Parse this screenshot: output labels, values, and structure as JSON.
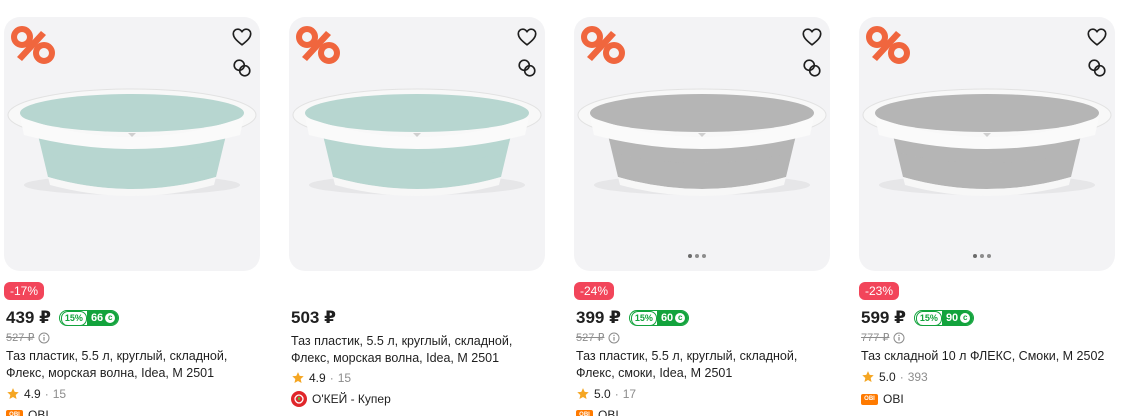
{
  "products": [
    {
      "discount": "-17%",
      "price": "439 ₽",
      "cashback_pct": "15%",
      "cashback_bonus": "66",
      "old_price": "527 ₽",
      "title": "Таз пластик, 5.5 л, круглый, складной, Флекс, морская волна, Idea, М 2501",
      "rating": "4.9",
      "reviews": "15",
      "store": "OBI",
      "store_logo": "obi-logo",
      "basin_color": "#b7d6d0",
      "gallery_dots": false
    },
    {
      "discount": "",
      "price": "503 ₽",
      "title": "Таз пластик, 5.5 л, круглый, складной, Флекс, морская волна, Idea, М 2501",
      "rating": "4.9",
      "reviews": "15",
      "store": "О'КЕЙ - Купер",
      "store_logo": "okey-logo",
      "basin_color": "#b7d6d0",
      "gallery_dots": false
    },
    {
      "discount": "-24%",
      "price": "399 ₽",
      "cashback_pct": "15%",
      "cashback_bonus": "60",
      "old_price": "527 ₽",
      "title": "Таз пластик, 5.5 л, круглый, складной, Флекс, смоки, Idea, М 2501",
      "rating": "5.0",
      "reviews": "17",
      "store": "OBI",
      "store_logo": "obi-logo",
      "basin_color": "#b5b5b5",
      "gallery_dots": true
    },
    {
      "discount": "-23%",
      "price": "599 ₽",
      "cashback_pct": "15%",
      "cashback_bonus": "90",
      "old_price": "777 ₽",
      "title": "Таз складной 10 л ФЛЕКС, Смоки, М 2502",
      "rating": "5.0",
      "reviews": "393",
      "store": "OBI",
      "store_logo": "obi-logo",
      "basin_color": "#b5b5b5",
      "gallery_dots": true
    }
  ],
  "colors": {
    "discount_badge": "#f2455a",
    "cashback_green": "#12a33c",
    "star": "#f5a623",
    "promo_orange": "#f0663e",
    "card_bg": "#f3f3f5"
  },
  "icons": {
    "promo": "percent-promo-icon",
    "favorite": "heart-icon",
    "compare": "compare-rings-icon",
    "info": "info-icon",
    "star": "star-icon"
  }
}
